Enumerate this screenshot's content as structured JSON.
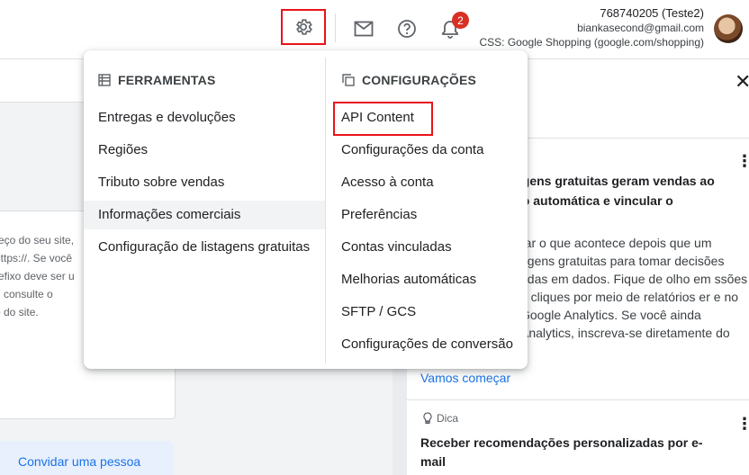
{
  "header": {
    "account_id": "768740205 (Teste2)",
    "email": "biankasecond@gmail.com",
    "css": "CSS: Google Shopping (google.com/shopping)",
    "notification_count": "2"
  },
  "icons": {
    "gear": "gear-icon",
    "mail": "mail-icon",
    "help": "help-icon",
    "bell": "bell-icon",
    "tools": "tools-icon",
    "settings": "settings-icon",
    "close": "close-icon",
    "bulb": "lightbulb-icon",
    "kebab": "more-vert-icon"
  },
  "colors": {
    "accent": "#1a73e8",
    "highlight_box": "#e8131a",
    "badge": "#d93025"
  },
  "menu": {
    "tools_heading": "FERRAMENTAS",
    "tools_items": [
      "Entregas e devoluções",
      "Regiões",
      "Tributo sobre vendas",
      "Informações comerciais",
      "Configuração de listagens gratuitas"
    ],
    "settings_heading": "CONFIGURAÇÕES",
    "settings_items": [
      "API Content",
      "Configurações da conta",
      "Acesso à conta",
      "Preferências",
      "Contas vinculadas",
      "Melhorias automáticas",
      "SFTP / GCS",
      "Configurações de conversão"
    ]
  },
  "background": {
    "card_lines": [
      "reço do seu site,",
      "https://. Se você",
      "refixo deve ser u",
      "u consulte o",
      "o do site."
    ],
    "invite_label": "Convidar uma pessoa",
    "panel_title": "agens gratuitas geram vendas ao ão automática e vincular o",
    "panel_body": "rar o que acontece depois que um agens gratuitas para tomar decisões adas em dados. Fique de olho em ssões e cliques por meio de relatórios er e no Google Analytics. Se você ainda Analytics, inscreva-se diretamente do",
    "panel_link": "Vamos começar",
    "tip_label": "Dica",
    "tip_title": "Receber recomendações personalizadas por e-mail"
  }
}
